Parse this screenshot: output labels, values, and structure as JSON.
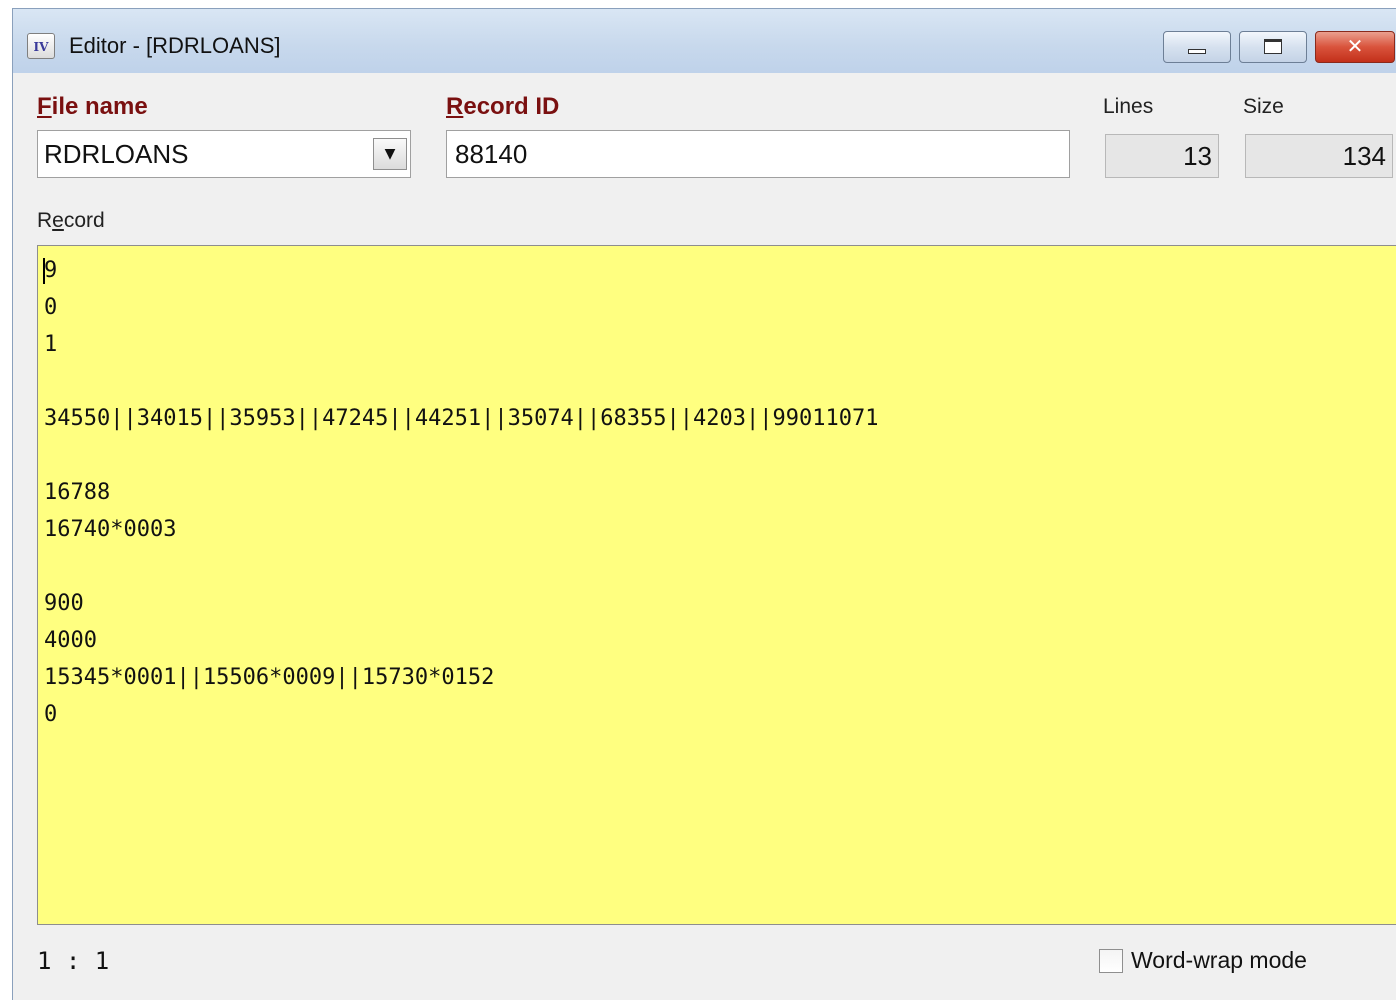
{
  "window": {
    "app_icon": "IV",
    "title": "Editor - [RDRLOANS]",
    "controls": {
      "minimize_icon": "minimize-icon",
      "maximize_icon": "maximize-icon",
      "close_icon": "close-icon",
      "close_glyph": "✕"
    }
  },
  "form": {
    "file_name_label_accel": "F",
    "file_name_label_rest": "ile name",
    "file_name_value": "RDRLOANS",
    "dropdown_glyph": "▼",
    "record_id_label_accel": "R",
    "record_id_label_rest": "ecord ID",
    "record_id_value": "88140",
    "lines_label": "Lines",
    "lines_value": "13",
    "size_label": "Size",
    "size_value": "134",
    "record_label_pre": "R",
    "record_label_accel": "e",
    "record_label_rest": "cord"
  },
  "editor": {
    "background": "#ffff80",
    "lines": [
      "9",
      "0",
      "1",
      "",
      "34550||34015||35953||47245||44251||35074||68355||4203||99011071",
      "",
      "16788",
      "16740*0003",
      "",
      "900",
      "4000",
      "15345*0001||15506*0009||15730*0152",
      "0"
    ]
  },
  "status": {
    "cursor_position": "1 : 1",
    "word_wrap_label": "Word-wrap mode",
    "word_wrap_checked": false
  }
}
